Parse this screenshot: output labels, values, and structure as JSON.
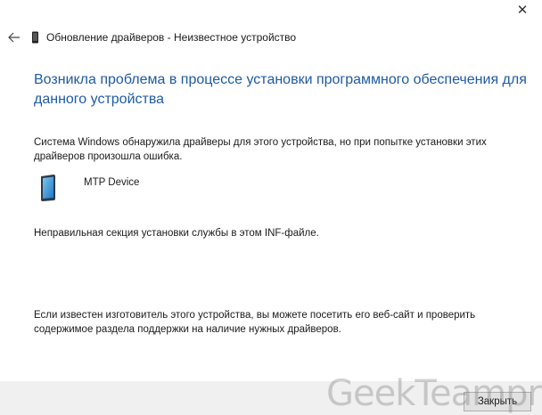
{
  "titlebar": {
    "close_glyph": "✕",
    "close_icon": "close-icon"
  },
  "nav": {
    "back_icon": "back-arrow-icon",
    "device_icon": "device-icon",
    "title": "Обновление драйверов - Неизвестное устройство"
  },
  "main": {
    "headline": "Возникла проблема в процессе установки программного обеспечения для данного устройства",
    "message": "Система Windows обнаружила драйверы для этого устройства, но при попытке установки этих драйверов произошла ошибка.",
    "device": {
      "icon": "mobile-device-icon",
      "name": "MTP Device"
    },
    "error_detail": "Неправильная секция установки службы в этом INF-файле.",
    "advice": "Если известен изготовитель этого устройства, вы можете посетить его веб-сайт и проверить содержимое раздела поддержки на наличие нужных драйверов."
  },
  "footer": {
    "close_label": "Закрыть"
  },
  "watermark": {
    "text": "GeekTeampro"
  },
  "colors": {
    "headline": "#1f5aa6",
    "footer_bg": "#f0f0f0",
    "window_bg": "#ffffff"
  }
}
